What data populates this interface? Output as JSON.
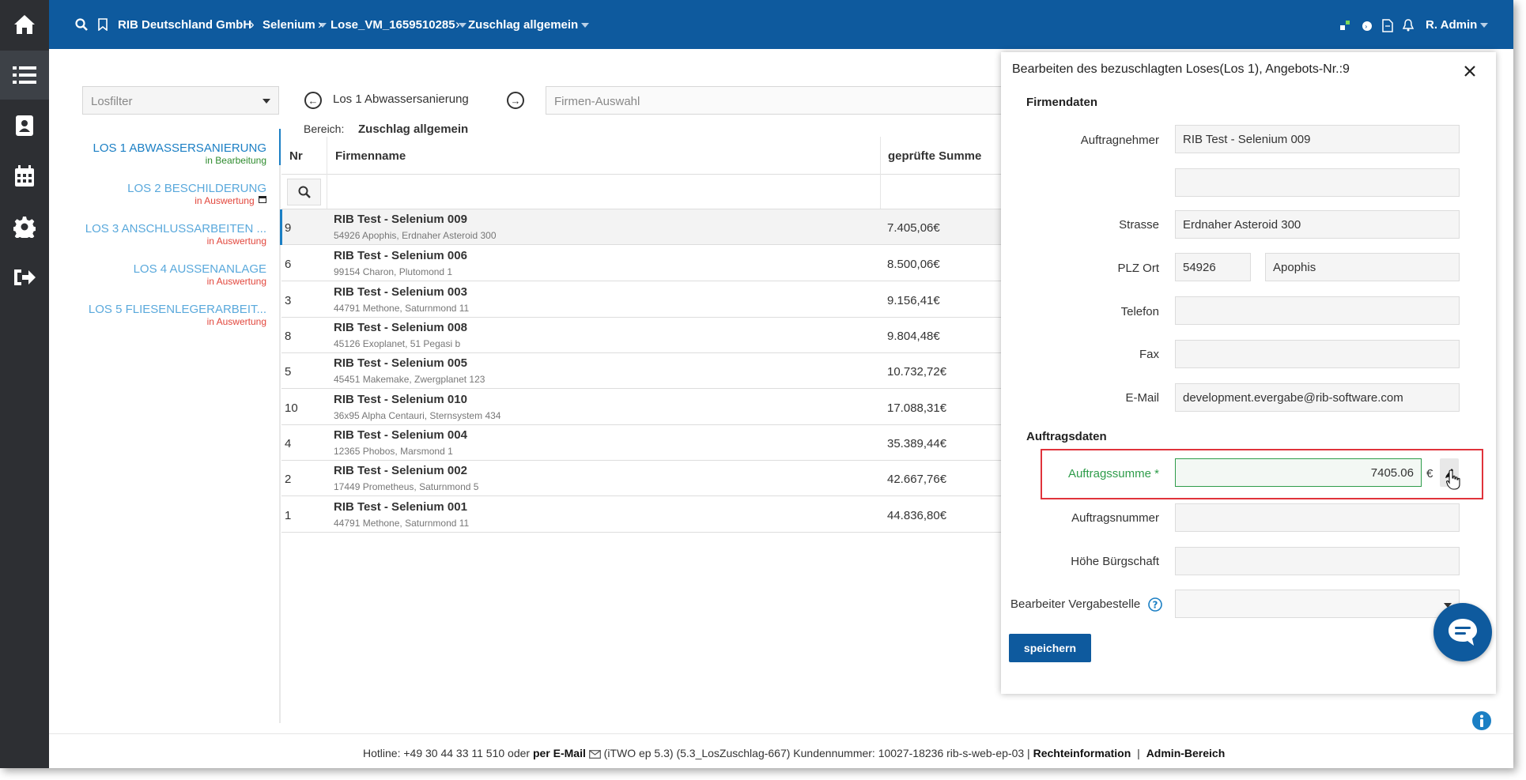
{
  "topbar": {
    "breadcrumb": [
      "RIB Deutschland GmbH",
      "Selenium",
      "Lose_VM_1659510285",
      "Zuschlag allgemein"
    ],
    "user": "R. Admin"
  },
  "filter": {
    "placeholder": "Losfilter"
  },
  "lots": [
    {
      "name": "LOS 1 ABWASSERSANIERUNG",
      "status": "in Bearbeitung"
    },
    {
      "name": "LOS 2 BESCHILDERUNG",
      "status": "in Auswertung"
    },
    {
      "name": "LOS 3 ANSCHLUSSARBEITEN ...",
      "status": "in Auswertung"
    },
    {
      "name": "LOS 4 AUSSENANLAGE",
      "status": "in Auswertung"
    },
    {
      "name": "LOS 5 FLIESENLEGERARBEIT...",
      "status": "in Auswertung"
    }
  ],
  "colors": {
    "status_active": "#2e8b2e",
    "status_eval": "#e2463c",
    "brand": "#0e5a9e",
    "required": "#2e9c4a"
  },
  "lot_header": {
    "current_lot": "Los 1 Abwassersanierung",
    "bereich_label": "Bereich:",
    "bereich_value": "Zuschlag allgemein",
    "firm_placeholder": "Firmen-Auswahl"
  },
  "table": {
    "headers": {
      "nr": "Nr",
      "firm": "Firmenname",
      "sum": "geprüfte Summe"
    },
    "rows": [
      {
        "nr": "9",
        "name": "RIB Test - Selenium 009",
        "address": "54926 Apophis, Erdnaher Asteroid 300",
        "sum": "7.405,06€"
      },
      {
        "nr": "6",
        "name": "RIB Test - Selenium 006",
        "address": "99154 Charon, Plutomond 1",
        "sum": "8.500,06€"
      },
      {
        "nr": "3",
        "name": "RIB Test - Selenium 003",
        "address": "44791 Methone, Saturnmond 11",
        "sum": "9.156,41€"
      },
      {
        "nr": "8",
        "name": "RIB Test - Selenium 008",
        "address": "45126 Exoplanet, 51 Pegasi b",
        "sum": "9.804,48€"
      },
      {
        "nr": "5",
        "name": "RIB Test - Selenium 005",
        "address": "45451 Makemake, Zwergplanet 123",
        "sum": "10.732,72€"
      },
      {
        "nr": "10",
        "name": "RIB Test - Selenium 010",
        "address": "36x95 Alpha Centauri, Sternsystem 434",
        "sum": "17.088,31€"
      },
      {
        "nr": "4",
        "name": "RIB Test - Selenium 004",
        "address": "12365 Phobos, Marsmond 1",
        "sum": "35.389,44€"
      },
      {
        "nr": "2",
        "name": "RIB Test - Selenium 002",
        "address": "17449 Prometheus, Saturnmond 5",
        "sum": "42.667,76€"
      },
      {
        "nr": "1",
        "name": "RIB Test - Selenium 001",
        "address": "44791 Methone, Saturnmond 11",
        "sum": "44.836,80€"
      }
    ]
  },
  "modal": {
    "title": "Bearbeiten des bezuschlagten Loses(Los 1), Angebots-Nr.:9",
    "section_firm": "Firmendaten",
    "section_order": "Auftragsdaten",
    "labels": {
      "contractor": "Auftragnehmer",
      "street": "Strasse",
      "zip_city": "PLZ Ort",
      "phone": "Telefon",
      "fax": "Fax",
      "email": "E-Mail",
      "order_sum": "Auftragssumme",
      "order_no": "Auftragsnummer",
      "guarantee": "Höhe Bürgschaft",
      "agent": "Bearbeiter Vergabestelle"
    },
    "values": {
      "contractor": "RIB Test - Selenium 009",
      "contractor2": "",
      "street": "Erdnaher Asteroid 300",
      "zip": "54926",
      "city": "Apophis",
      "phone": "",
      "fax": "",
      "email": "development.evergabe@rib-software.com",
      "order_sum": "7405.06",
      "order_no": "",
      "guarantee": "",
      "agent": ""
    },
    "required_mark": "*",
    "currency": "€",
    "save_label": "speichern"
  },
  "footer": {
    "hotline": "Hotline: +49 30 44 33 11 510 oder",
    "per_email": "per E-Mail",
    "version": "(iTWO ep 5.3) (5.3_LosZuschlag-667)   Kundennummer: 10027-18236 rib-s-web-ep-03 |",
    "legal": "Rechteinformation",
    "pipe": "|",
    "admin": "Admin-Bereich"
  }
}
